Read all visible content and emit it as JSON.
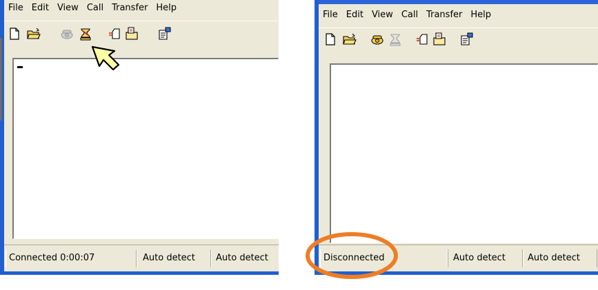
{
  "menu": [
    "File",
    "Edit",
    "View",
    "Call",
    "Transfer",
    "Help"
  ],
  "toolbar_icons": [
    "new-document-icon",
    "open-folder-icon",
    "call-icon",
    "disconnect-icon",
    "send-icon",
    "receive-icon",
    "properties-icon"
  ],
  "left": {
    "status_connection": "Connected 0:00:07",
    "status_mode1": "Auto detect",
    "status_mode2": "Auto detect"
  },
  "right": {
    "status_connection": "Disconnected",
    "status_mode1": "Auto detect",
    "status_mode2": "Auto detect"
  },
  "colors": {
    "window_frame": "#1f5fd0",
    "chrome": "#ece9d8",
    "highlight_ring": "#ef7d26",
    "pointer_fill": "#ffffa8"
  }
}
